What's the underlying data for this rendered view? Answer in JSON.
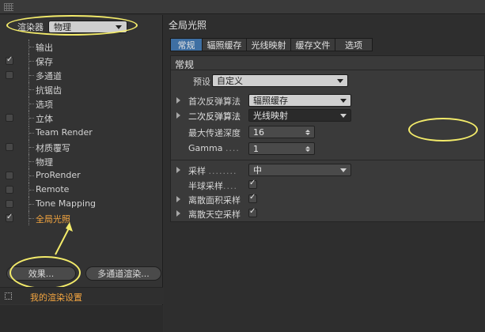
{
  "renderer": {
    "label": "渲染器",
    "value": "物理"
  },
  "tree": [
    {
      "label": "输出",
      "checkbox": false,
      "checked": false,
      "active": false
    },
    {
      "label": "保存",
      "checkbox": true,
      "checked": true,
      "active": false
    },
    {
      "label": "多通道",
      "checkbox": true,
      "checked": false,
      "active": false
    },
    {
      "label": "抗锯齿",
      "checkbox": false,
      "checked": false,
      "active": false
    },
    {
      "label": "选项",
      "checkbox": false,
      "checked": false,
      "active": false
    },
    {
      "label": "立体",
      "checkbox": true,
      "checked": false,
      "active": false
    },
    {
      "label": "Team Render",
      "checkbox": false,
      "checked": false,
      "active": false
    },
    {
      "label": "材质覆写",
      "checkbox": true,
      "checked": false,
      "active": false
    },
    {
      "label": "物理",
      "checkbox": false,
      "checked": false,
      "active": false
    },
    {
      "label": "ProRender",
      "checkbox": true,
      "checked": false,
      "active": false
    },
    {
      "label": "Remote",
      "checkbox": true,
      "checked": false,
      "active": false
    },
    {
      "label": "Tone Mapping",
      "checkbox": true,
      "checked": false,
      "active": false
    },
    {
      "label": "全局光照",
      "checkbox": true,
      "checked": true,
      "active": true
    }
  ],
  "buttons": {
    "effects": "效果...",
    "multipass_render": "多通道渲染..."
  },
  "settings_name": "我的渲染设置",
  "section_title": "全局光照",
  "tabs": [
    {
      "label": "常规",
      "active": true
    },
    {
      "label": "辐照缓存",
      "active": false
    },
    {
      "label": "光线映射",
      "active": false
    },
    {
      "label": "缓存文件",
      "active": false
    },
    {
      "label": "选项",
      "active": false
    }
  ],
  "panel": {
    "heading": "常规",
    "preset": {
      "label": "预设",
      "value": "自定义"
    },
    "primary": {
      "label": "首次反弹算法",
      "value": "辐照缓存"
    },
    "secondary": {
      "label": "二次反弹算法",
      "value": "光线映射"
    },
    "depth": {
      "label": "最大传递深度",
      "value": "16"
    },
    "gamma": {
      "label": "Gamma",
      "dots": "....",
      "value": "1"
    },
    "sampling": {
      "label": "采样",
      "dots": "........",
      "value": "中"
    },
    "hemisphere": {
      "label": "半球采样",
      "dots": "....",
      "checked": true
    },
    "area": {
      "label": "离散面积采样",
      "checked": true
    },
    "sky": {
      "label": "离散天空采样",
      "checked": true
    }
  },
  "colors": {
    "active_tab": "#3e6fa3",
    "highlight_text": "#f4a640",
    "annotation": "#f3eb6a"
  }
}
